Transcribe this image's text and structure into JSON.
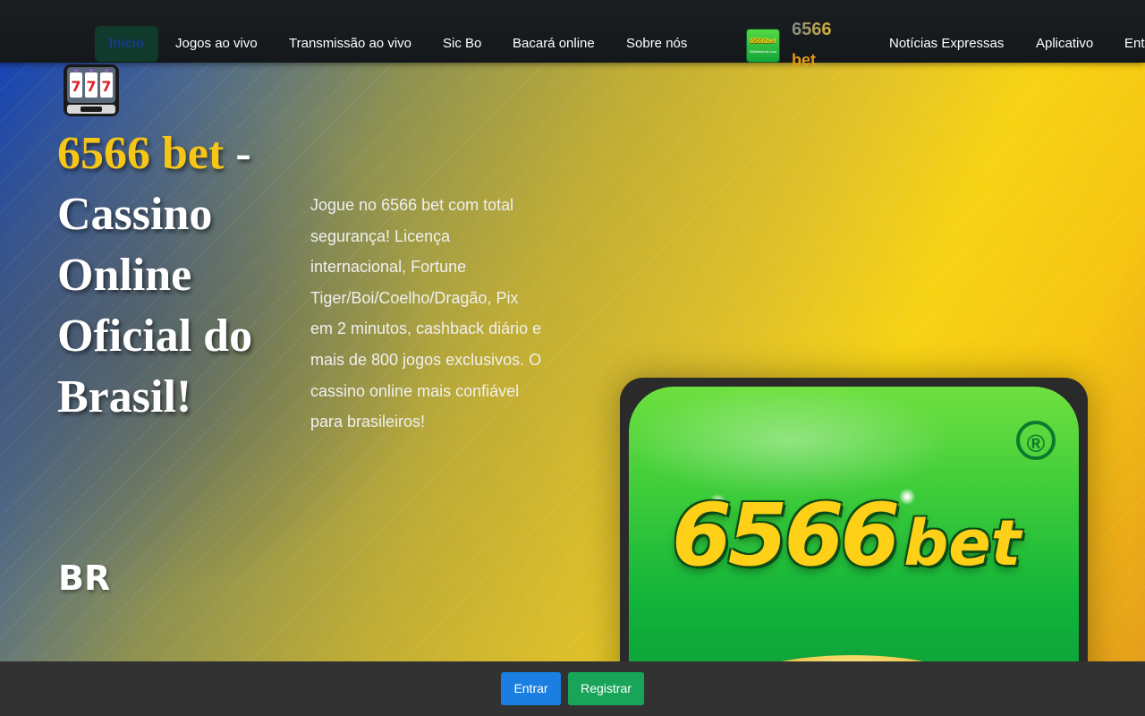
{
  "nav": {
    "items": [
      {
        "label": "Início",
        "active": true
      },
      {
        "label": "Jogos ao vivo"
      },
      {
        "label": "Transmissão ao vivo"
      },
      {
        "label": "Sic Bo"
      },
      {
        "label": "Bacará online"
      },
      {
        "label": "Sobre nós"
      },
      {
        "label": "Notícias Expressas"
      },
      {
        "label": "Aplicativo"
      },
      {
        "label": "Entrar"
      }
    ],
    "brand_line1": "6566",
    "brand_line2": "bet",
    "logo_icon": "6566bet-logo-icon",
    "logo_mini_text": "6566bet",
    "logo_mini_sub": "6566bethub.com"
  },
  "hero": {
    "title_yellow": "6566 bet",
    "title_rest": " - Cassino Online Oficial do Brasil!",
    "badge": "BR",
    "slot_icon": "slot-machine-icon",
    "description": "Jogue no 6566 bet com total segurança! Licença internacional, Fortune Tiger/Boi/Coelho/Dragão, Pix em 2 minutos, cashback diário e mais de 800 jogos exclusivos. O cassino online mais confiável para brasileiros!",
    "app_image": {
      "num_text": "6566",
      "bet_text": "bet",
      "registered_mark": "®"
    }
  },
  "bottom_bar": {
    "login_label": "Entrar",
    "register_label": "Registrar"
  },
  "colors": {
    "nav_bg": "#15191c",
    "active_tab_bg": "#0f3a2c",
    "title_yellow": "#f5c518",
    "login_button": "#1a7fe0",
    "register_button": "#18a55a",
    "bottom_bar_bg": "#323232"
  }
}
